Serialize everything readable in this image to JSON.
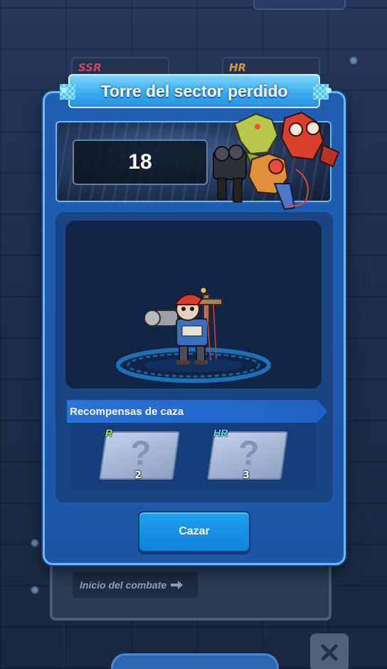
{
  "background": {
    "cards": [
      {
        "rarity": "SSR"
      },
      {
        "rarity": "HR"
      }
    ],
    "start_battle_label": "Inicio del combate"
  },
  "modal": {
    "title": "Torre del sector perdido",
    "floor_number": "18",
    "rewards_title": "Recompensas de caza",
    "rewards": [
      {
        "rarity": "R",
        "count": "2",
        "icon": "question-mark"
      },
      {
        "rarity": "HR",
        "count": "3",
        "icon": "question-mark"
      }
    ],
    "hunt_button_label": "Cazar"
  },
  "colors": {
    "modal_bg": "#1f5fb2",
    "title_banner": "#39a9ee",
    "hunt_button": "#1fa1f0",
    "rarity_r": "#8cf25a",
    "rarity_hr": "#5fd6ff"
  }
}
